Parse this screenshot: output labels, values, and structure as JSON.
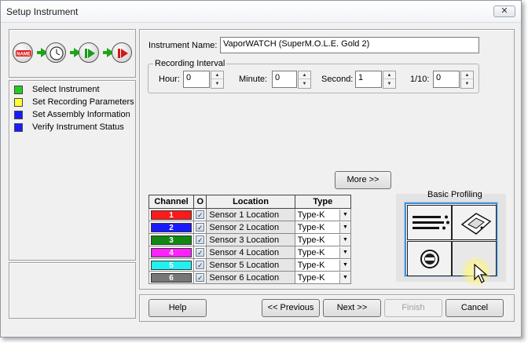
{
  "window": {
    "title": "Setup Instrument",
    "close_glyph": "✕"
  },
  "wizard_icons": [
    {
      "name": "name-icon",
      "label": "NAME"
    },
    {
      "name": "clock-icon"
    },
    {
      "name": "play-icon"
    },
    {
      "name": "record-icon"
    }
  ],
  "steps": [
    {
      "label": "Select Instrument",
      "color": "#22cc22"
    },
    {
      "label": "Set Recording Parameters",
      "color": "#ffff33"
    },
    {
      "label": "Set Assembly Information",
      "color": "#1a1aff"
    },
    {
      "label": "Verify Instrument Status",
      "color": "#1a1aff"
    }
  ],
  "instrument": {
    "name_label": "Instrument Name:",
    "name_value": "VaporWATCH (SuperM.O.L.E. Gold 2)"
  },
  "recording_interval": {
    "title": "Recording Interval",
    "fields": [
      {
        "label": "Hour:",
        "value": "0"
      },
      {
        "label": "Minute:",
        "value": "0"
      },
      {
        "label": "Second:",
        "value": "1"
      },
      {
        "label": "1/10:",
        "value": "0"
      }
    ]
  },
  "more_button": "More >>",
  "table": {
    "headers": [
      "Channel",
      "O",
      "Location",
      "Type"
    ],
    "rows": [
      {
        "channel": "1",
        "color": "#ff1a1a",
        "checked": true,
        "location": "Sensor 1 Location",
        "type": "Type-K"
      },
      {
        "channel": "2",
        "color": "#1a1aff",
        "checked": true,
        "location": "Sensor 2 Location",
        "type": "Type-K"
      },
      {
        "channel": "3",
        "color": "#118811",
        "checked": true,
        "location": "Sensor 3 Location",
        "type": "Type-K"
      },
      {
        "channel": "4",
        "color": "#ff22ff",
        "checked": true,
        "location": "Sensor 4 Location",
        "type": "Type-K"
      },
      {
        "channel": "5",
        "color": "#22f0f0",
        "checked": true,
        "location": "Sensor 5 Location",
        "type": "Type-K"
      },
      {
        "channel": "6",
        "color": "#777777",
        "checked": true,
        "location": "Sensor 6 Location",
        "type": "Type-K"
      }
    ]
  },
  "profiling": {
    "label": "Basic Profiling"
  },
  "nav": {
    "help": "Help",
    "previous": "<< Previous",
    "next": "Next >>",
    "finish": "Finish",
    "cancel": "Cancel"
  }
}
